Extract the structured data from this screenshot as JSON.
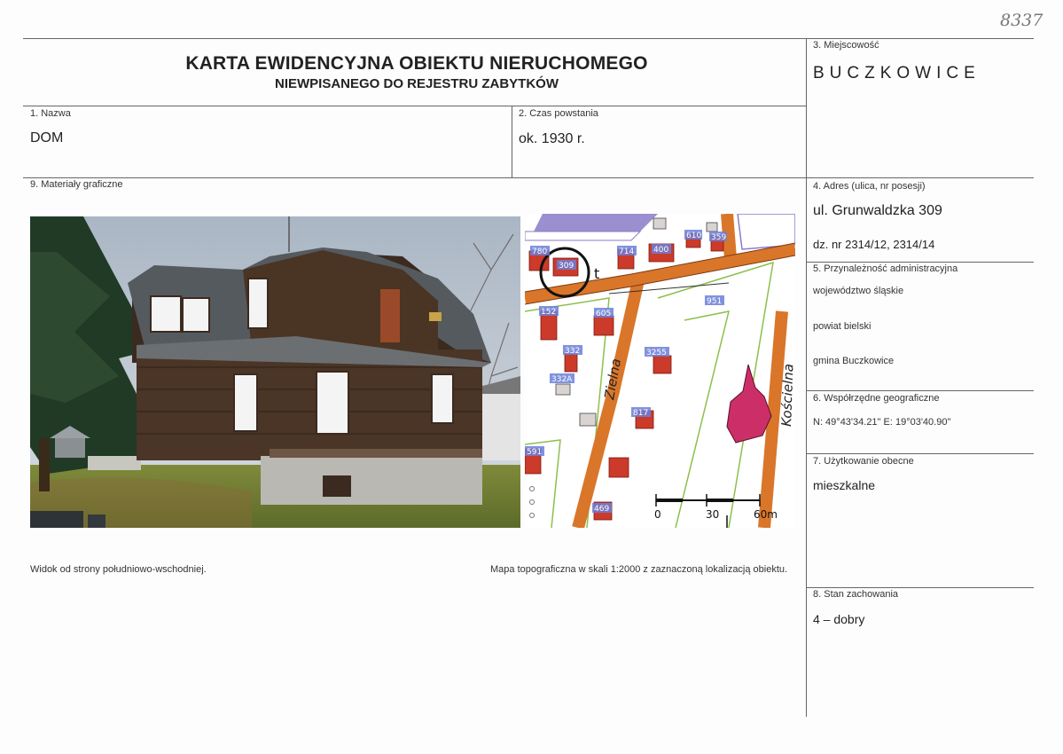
{
  "header": {
    "title": "KARTA EWIDENCYJNA OBIEKTU NIERUCHOMEGO",
    "subtitle": "NIEWPISANEGO DO REJESTRU ZABYTKÓW",
    "handwritten_number": "8337"
  },
  "fields": {
    "nazwa": {
      "label": "1. Nazwa",
      "value": "DOM"
    },
    "czas": {
      "label": "2. Czas powstania",
      "value": "ok. 1930 r."
    },
    "miejscowosc": {
      "label": "3. Miejscowość",
      "value": "BUCZKOWICE"
    },
    "adres": {
      "label": "4. Adres (ulica, nr posesji)",
      "value": "ul. Grunwaldzka 309",
      "plots": "dz. nr 2314/12, 2314/14"
    },
    "admin": {
      "label": "5. Przynależność administracyjna",
      "wojewodztwo": "województwo śląskie",
      "powiat": "powiat bielski",
      "gmina": "gmina Buczkowice"
    },
    "wspolrzedne": {
      "label": "6. Współrzędne geograficzne",
      "value": "N: 49°43'34.21\" E: 19°03'40.90\""
    },
    "uzytkowanie": {
      "label": "7. Użytkowanie obecne",
      "value": "mieszkalne"
    },
    "stan": {
      "label": "8. Stan zachowania",
      "value": "4 – dobry"
    },
    "materialy": {
      "label": "9. Materiały graficzne"
    }
  },
  "captions": {
    "photo": "Widok od strony południowo-wschodniej.",
    "map": "Mapa topograficzna w skali 1:2000 z zaznaczoną lokalizacją obiektu."
  },
  "map": {
    "house_numbers": [
      "780",
      "309",
      "714",
      "400",
      "610",
      "359",
      "152",
      "605",
      "332",
      "332A",
      "3255",
      "817",
      "591",
      "469",
      "951"
    ],
    "streets": [
      "Zielna",
      "Kościelna"
    ],
    "marker_letter": "t",
    "scale": {
      "zero": "0",
      "mid": "30",
      "end": "60m"
    },
    "colors": {
      "road": "#d9762a",
      "building": "#cc3a2a",
      "church": "#cc2f68",
      "bg": "#ffffff",
      "green": "#8dbf4e",
      "label_box": "#6b7fd8"
    }
  }
}
